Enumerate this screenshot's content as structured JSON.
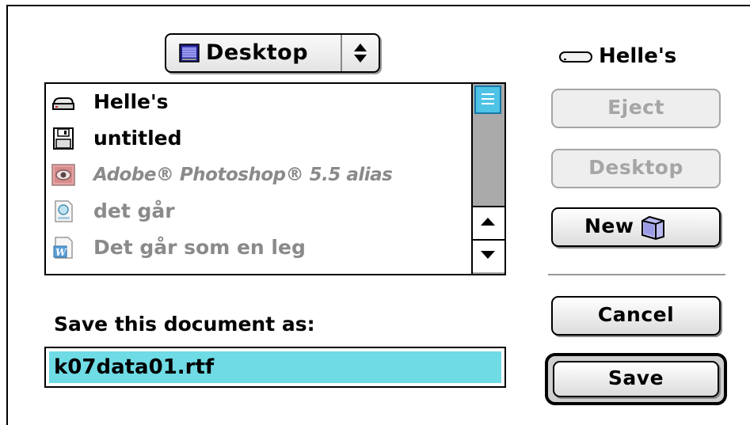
{
  "location": {
    "label": "Desktop",
    "icon": "desktop-icon",
    "arrows_icon": "updown-arrows-icon"
  },
  "volume": {
    "label": "Helle's",
    "icon": "hard-disk-icon"
  },
  "file_list": [
    {
      "label": "Helle's",
      "icon": "hard-disk-icon",
      "enabled": true,
      "style": "normal"
    },
    {
      "label": "untitled",
      "icon": "floppy-disk-icon",
      "enabled": true,
      "style": "normal"
    },
    {
      "label": "Adobe® Photoshop® 5.5 alias",
      "icon": "photoshop-alias-icon",
      "enabled": false,
      "style": "italic"
    },
    {
      "label": "det går",
      "icon": "simpletext-document-icon",
      "enabled": false,
      "style": "normal"
    },
    {
      "label": "Det går som en leg",
      "icon": "word-document-icon",
      "enabled": false,
      "style": "normal"
    }
  ],
  "save_as": {
    "prompt": "Save this document as:",
    "filename": "k07data01.rtf"
  },
  "buttons": {
    "eject": "Eject",
    "desktop": "Desktop",
    "new": "New",
    "cancel": "Cancel",
    "save": "Save"
  },
  "colors": {
    "selection": "#6fdbe5",
    "scroll_thumb": "#4fc3e6",
    "disabled_text": "#a5a5a5"
  }
}
